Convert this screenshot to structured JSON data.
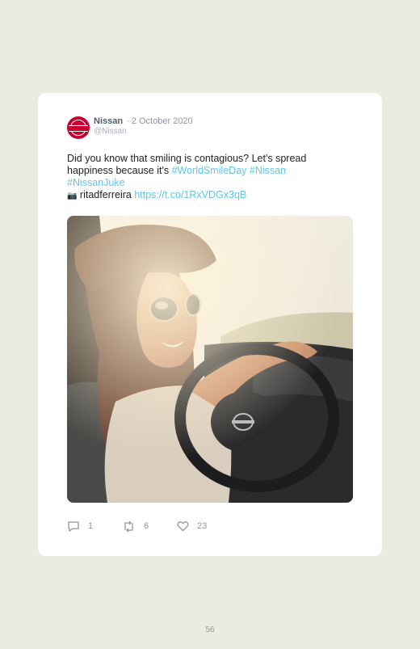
{
  "tweet": {
    "author_name": "Nissan",
    "separator": "·",
    "date": "2 October 2020",
    "handle": "@Nissan",
    "avatar_icon": "nissan-logo-icon",
    "text_line1": "Did you know that smiling is contagious? Let's spread",
    "text_line2": "happiness because it's ",
    "hashtag1": "#WorldSmileDay",
    "hashtag2": "#Nissan",
    "hashtag3": "#NissanJuke",
    "camera_emoji": "📷",
    "photo_credit": " ritadferreira ",
    "link": "https://t.co/1RxVDGx3qB",
    "photo_icon": "woman-driving-photo"
  },
  "actions": {
    "replies": "1",
    "retweets": "6",
    "likes": "23",
    "reply_icon": "reply-icon",
    "retweet_icon": "retweet-icon",
    "like_icon": "heart-icon"
  },
  "page_number": "56",
  "colors": {
    "background": "#ebebdf",
    "card": "#ffffff",
    "link": "#5ec5ee",
    "brand": "#c3002f",
    "meta": "#8c97a1"
  }
}
